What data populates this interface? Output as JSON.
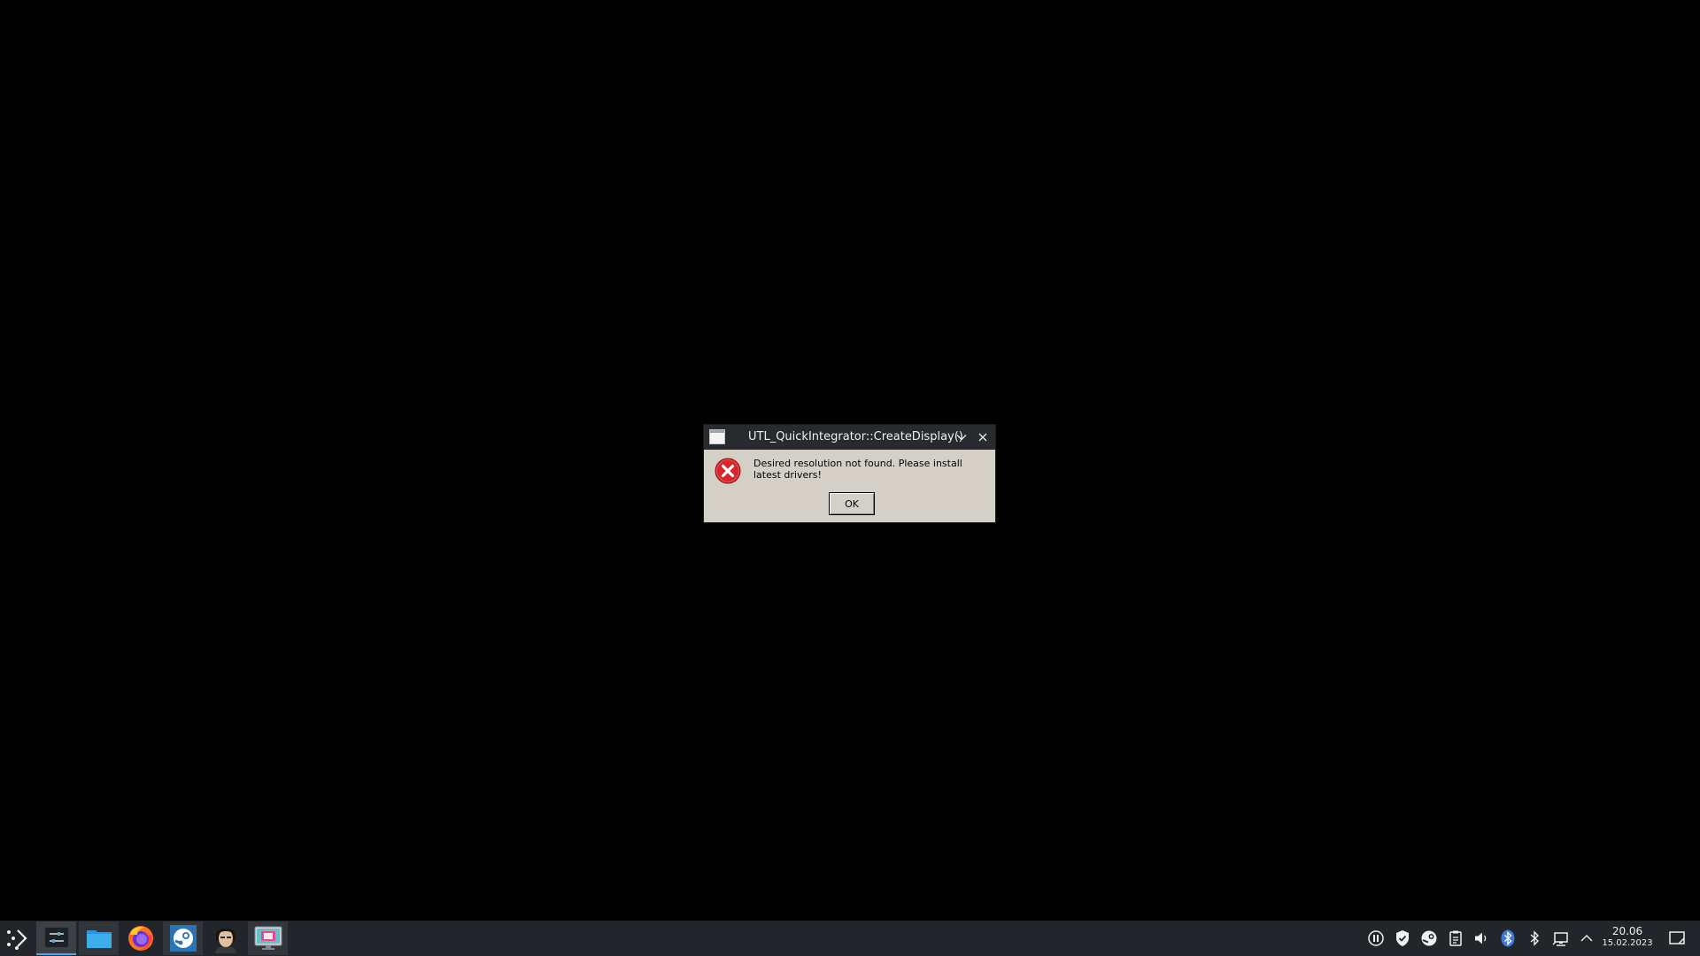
{
  "dialog": {
    "title": "UTL_QuickIntegrator::CreateDisplay()",
    "message": "Desired resolution not found. Please install latest drivers!",
    "ok_label": "OK",
    "icon": "error-icon"
  },
  "taskbar": {
    "launcher_icon": "application-launcher-icon",
    "tasks": [
      {
        "name": "system-settings",
        "icon": "sliders-icon"
      },
      {
        "name": "file-manager",
        "icon": "folder-icon"
      },
      {
        "name": "firefox",
        "icon": "firefox-icon"
      },
      {
        "name": "steam",
        "icon": "steam-icon"
      },
      {
        "name": "portrait-app",
        "icon": "portrait-icon"
      },
      {
        "name": "display-app",
        "icon": "monitor-icon"
      }
    ],
    "tray_icons": [
      "pause-icon",
      "shield-icon",
      "steam-tray-icon",
      "clipboard-icon",
      "volume-icon",
      "bluetooth-badge-icon",
      "bluetooth-icon",
      "network-icon",
      "chevron-up-icon"
    ],
    "clock": {
      "time": "20.06",
      "date": "15.02.2023"
    },
    "show_desktop_icon": "show-desktop-icon"
  },
  "colors": {
    "desktop": "#000000",
    "taskbar": "#222529",
    "titlebar": "#272a2e",
    "dialog_body": "#d4d0c8",
    "accent": "#3daee9",
    "error_red": "#d9262c"
  }
}
